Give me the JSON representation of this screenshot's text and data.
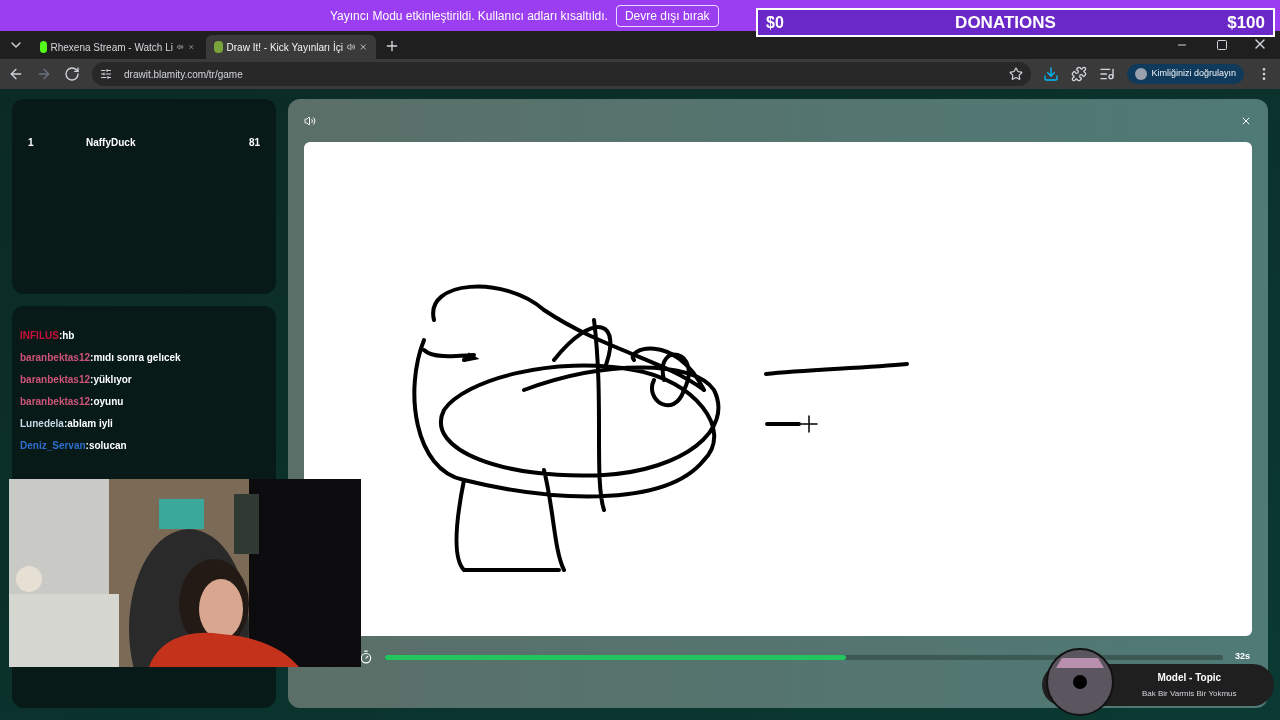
{
  "banner": {
    "message": "Yayıncı Modu etkinleştirildi. Kullanıcı adları kısaltıldı.",
    "button": "Devre dışı bırak"
  },
  "donations": {
    "start": "$0",
    "title": "DONATIONS",
    "goal": "$100"
  },
  "tabs": [
    {
      "title": "Rhexena Stream - Watch Li",
      "selected": false
    },
    {
      "title": "Draw It! - Kick Yayınları İçi",
      "selected": true
    }
  ],
  "address": "drawit.blamity.com/tr/game",
  "profile_button": "Kimliğinizi doğrulayın",
  "leaderboard": [
    {
      "rank": "1",
      "name": "NaffyDuck",
      "score": "81"
    }
  ],
  "chat": [
    {
      "user": "INFILUS",
      "color": "#c8103c",
      "text": ":hb"
    },
    {
      "user": "baranbektas12",
      "color": "#d0547a",
      "text": ":mıdı sonra gelıcek"
    },
    {
      "user": "baranbektas12",
      "color": "#d0547a",
      "text": ":yüklıyor"
    },
    {
      "user": "baranbektas12",
      "color": "#d0547a",
      "text": ":oyunu"
    },
    {
      "user": "Lunedela",
      "color": "#c9d6e8",
      "text": ":ablam iyli"
    },
    {
      "user": "Deniz_Servan",
      "color": "#2f6fcf",
      "text": ":solucan"
    }
  ],
  "timer": {
    "level": 0.55,
    "reading": "32s"
  },
  "now_playing": {
    "title": "Model - Topic",
    "subtitle": "Bak Bir Varmis Bir Yokmus"
  }
}
